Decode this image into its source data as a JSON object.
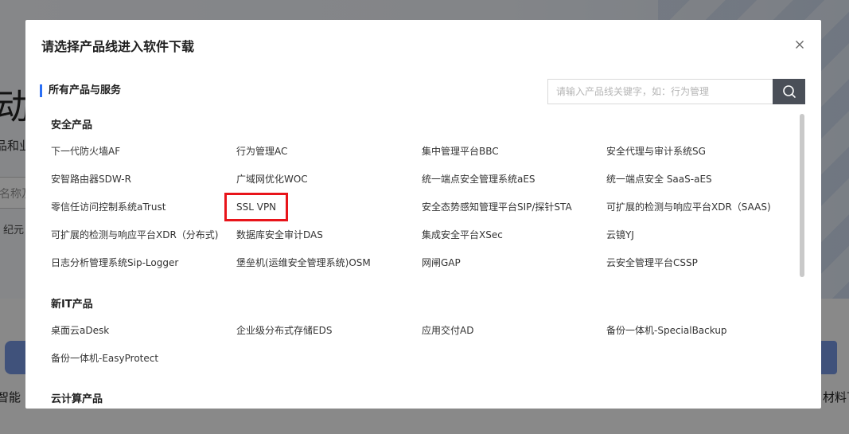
{
  "background": {
    "hero_title_fragment": "动服",
    "hero_sub_fragment": "品和业",
    "search_fragment": "名称及",
    "hint_fragment": "纪元",
    "left_label_fragment": "智能",
    "right_label_fragment": "材料下"
  },
  "modal": {
    "title": "请选择产品线进入软件下载",
    "close_icon": "close-icon",
    "section_title": "所有产品与服务",
    "search": {
      "placeholder": "请输入产品线关键字，如：行为管理",
      "value": "",
      "icon": "search-icon"
    },
    "categories": [
      {
        "name": "安全产品",
        "items": [
          "下一代防火墙AF",
          "行为管理AC",
          "集中管理平台BBC",
          "安全代理与审计系统SG",
          "安智路由器SDW-R",
          "广域网优化WOC",
          "统一端点安全管理系统aES",
          "统一端点安全 SaaS-aES",
          "零信任访问控制系统aTrust",
          "SSL VPN",
          "安全态势感知管理平台SIP/探针STA",
          "可扩展的检测与响应平台XDR（SAAS)",
          "可扩展的检测与响应平台XDR（分布式)",
          "数据库安全审计DAS",
          "集成安全平台XSec",
          "云镜YJ",
          "日志分析管理系统Sip-Logger",
          "堡垒机(运维安全管理系统)OSM",
          "网闸GAP",
          "云安全管理平台CSSP"
        ]
      },
      {
        "name": "新IT产品",
        "items": [
          "桌面云aDesk",
          "企业级分布式存储EDS",
          "应用交付AD",
          "备份一体机-SpecialBackup",
          "备份一体机-EasyProtect"
        ]
      },
      {
        "name": "云计算产品",
        "items": []
      }
    ],
    "highlighted_item": "SSL VPN",
    "highlight_color": "#e8141a",
    "accent_color": "#2a6ff5"
  }
}
